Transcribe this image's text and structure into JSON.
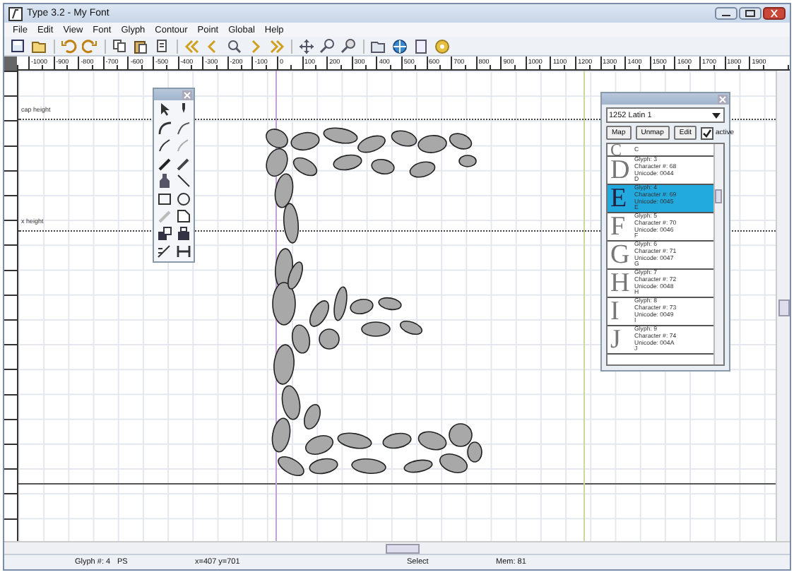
{
  "window": {
    "title": "Type 3.2 - My Font"
  },
  "menu": [
    "File",
    "Edit",
    "View",
    "Font",
    "Glyph",
    "Contour",
    "Point",
    "Global",
    "Help"
  ],
  "ruler": {
    "labels": [
      "-1000",
      "-900",
      "-800",
      "-700",
      "-600",
      "-500",
      "-400",
      "-300",
      "-200",
      "-100",
      "0",
      "100",
      "200",
      "300",
      "400",
      "500",
      "600",
      "700",
      "800",
      "900",
      "1000",
      "1100",
      "1200",
      "1300",
      "1400",
      "1500",
      "1600",
      "1700",
      "1800",
      "1900"
    ]
  },
  "guides": [
    {
      "label": "cap height"
    },
    {
      "label": "x height"
    }
  ],
  "glyph_panel": {
    "encoding": "1252 Latin 1",
    "buttons": [
      "Map",
      "Unmap",
      "Edit"
    ],
    "active": {
      "label": "active",
      "checked": true
    },
    "glyphs": [
      {
        "letter": "C",
        "name": "C",
        "selected": false
      },
      {
        "letter": "D",
        "glyph": "Glyph: 3",
        "character": "Character #: 68",
        "unicode": "Unicode: 0044",
        "name": "D",
        "selected": false
      },
      {
        "letter": "E",
        "glyph": "Glyph: 4",
        "character": "Character #: 69",
        "unicode": "Unicode: 0045",
        "name": "E",
        "selected": true
      },
      {
        "letter": "F",
        "glyph": "Glyph: 5",
        "character": "Character #: 70",
        "unicode": "Unicode: 0046",
        "name": "F",
        "selected": false
      },
      {
        "letter": "G",
        "glyph": "Glyph: 6",
        "character": "Character #: 71",
        "unicode": "Unicode: 0047",
        "name": "G",
        "selected": false
      },
      {
        "letter": "H",
        "glyph": "Glyph: 7",
        "character": "Character #: 72",
        "unicode": "Unicode: 0048",
        "name": "H",
        "selected": false
      },
      {
        "letter": "I",
        "glyph": "Glyph: 8",
        "character": "Character #: 73",
        "unicode": "Unicode: 0049",
        "name": "I",
        "selected": false
      },
      {
        "letter": "J",
        "glyph": "Glyph: 9",
        "character": "Character #: 74",
        "unicode": "Unicode: 004A",
        "name": "J",
        "selected": false
      }
    ]
  },
  "status_bar": [
    "Glyph #: 4",
    "PS",
    "x=407 y=701",
    "Select",
    "Mem: 81"
  ]
}
